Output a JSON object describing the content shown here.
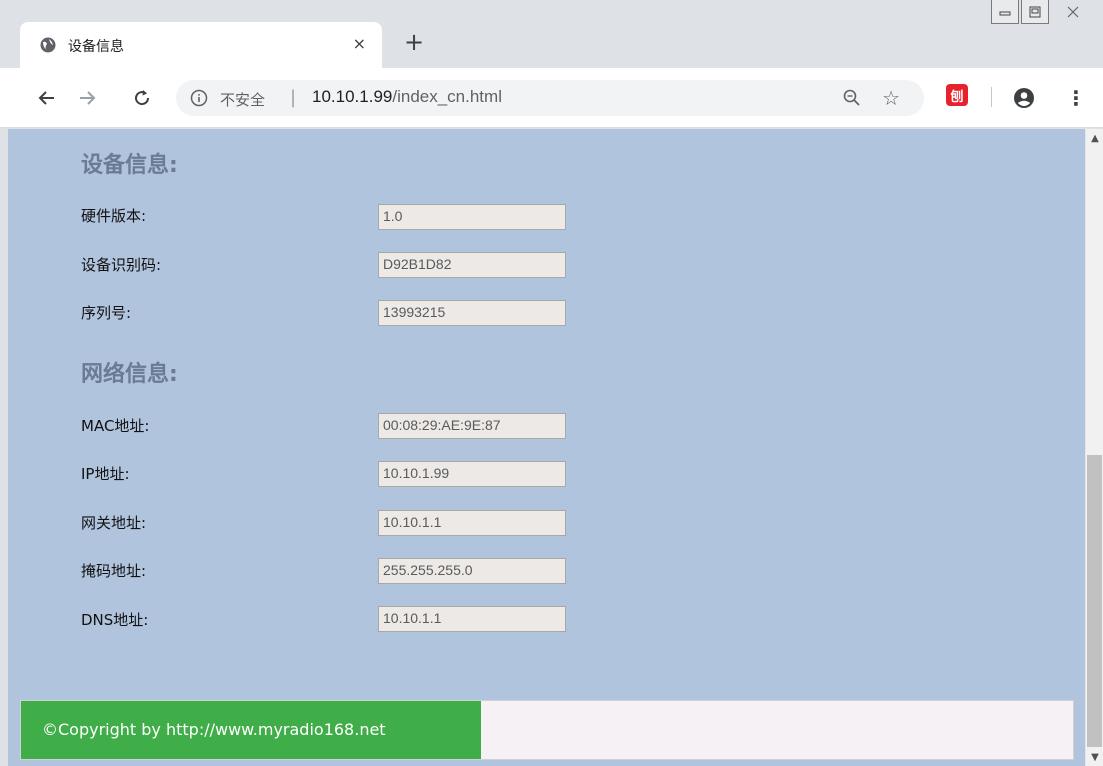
{
  "browser": {
    "tab_title": "设备信息",
    "tab_close": "×",
    "new_tab": "+",
    "insecure_label": "不安全",
    "separator": "|",
    "url_host": "10.10.1.99",
    "url_path": "/index_cn.html",
    "star": "☆",
    "ext_label": "刨",
    "menu": "⋮"
  },
  "device_section": {
    "title": "设备信息:",
    "rows": [
      {
        "label": "硬件版本:",
        "value": "1.0"
      },
      {
        "label": "设备识别码:",
        "value": "D92B1D82"
      },
      {
        "label": "序列号:",
        "value": "13993215"
      }
    ]
  },
  "network_section": {
    "title": "网络信息:",
    "rows": [
      {
        "label": "MAC地址:",
        "value": "00:08:29:AE:9E:87"
      },
      {
        "label": "IP地址:",
        "value": "10.10.1.99"
      },
      {
        "label": "网关地址:",
        "value": "10.10.1.1"
      },
      {
        "label": "掩码地址:",
        "value": "255.255.255.0"
      },
      {
        "label": "DNS地址:",
        "value": "10.10.1.1"
      }
    ]
  },
  "footer": {
    "copyright": "©Copyright by http://www.myradio168.net"
  },
  "colors": {
    "page_bg": "#b0c4de",
    "section_title": "#6b7b95",
    "footer_green": "#3fae49"
  }
}
